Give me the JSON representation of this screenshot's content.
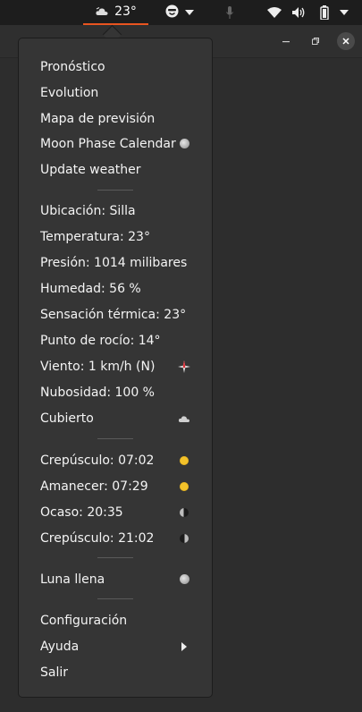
{
  "topbar": {
    "weather_temp": "23°"
  },
  "menu": {
    "group1": [
      {
        "label": "Pronóstico",
        "icon": ""
      },
      {
        "label": "Evolution",
        "icon": ""
      },
      {
        "label": "Mapa de previsión",
        "icon": ""
      },
      {
        "label": "Moon Phase Calendar",
        "icon": "full-moon-icon"
      },
      {
        "label": "Update weather",
        "icon": ""
      }
    ],
    "group2": [
      {
        "label": "Ubicación: Silla",
        "icon": ""
      },
      {
        "label": "Temperatura: 23°",
        "icon": ""
      },
      {
        "label": "Presión: 1014 milibares",
        "icon": ""
      },
      {
        "label": "Humedad: 56 %",
        "icon": ""
      },
      {
        "label": "Sensación térmica: 23°",
        "icon": ""
      },
      {
        "label": "Punto de rocío: 14°",
        "icon": ""
      },
      {
        "label": "Viento: 1 km/h (N)",
        "icon": "compass-icon"
      },
      {
        "label": "Nubosidad: 100 %",
        "icon": ""
      },
      {
        "label": "Cubierto",
        "icon": "cloud-icon"
      }
    ],
    "group3": [
      {
        "label": "Crepúsculo: 07:02",
        "icon": "sun-icon"
      },
      {
        "label": "Amanecer: 07:29",
        "icon": "sun-icon"
      },
      {
        "label": "Ocaso: 20:35",
        "icon": "half-moon-icon"
      },
      {
        "label": "Crepúsculo: 21:02",
        "icon": "half-moon-icon"
      }
    ],
    "group4": [
      {
        "label": "Luna llena",
        "icon": "full-moon-icon"
      }
    ],
    "group5": [
      {
        "label": "Configuración",
        "icon": ""
      },
      {
        "label": "Ayuda",
        "icon": "submenu-arrow-icon"
      },
      {
        "label": "Salir",
        "icon": ""
      }
    ]
  },
  "colors": {
    "accent": "#e95420",
    "menu_bg": "#353535",
    "topbar_bg": "#1d1d1d"
  }
}
